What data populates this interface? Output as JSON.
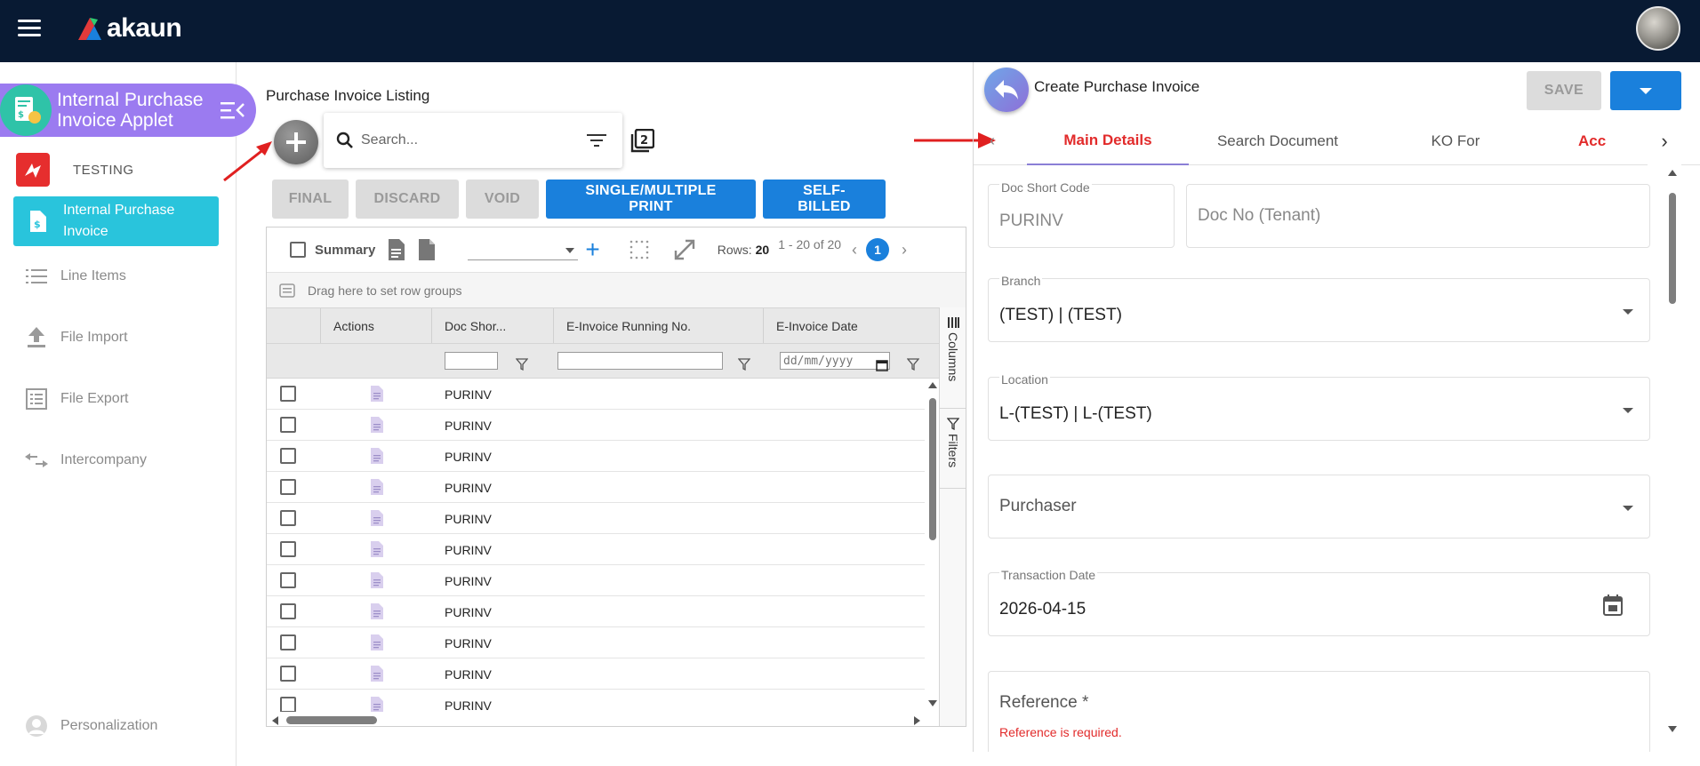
{
  "app": {
    "brand": "akaun"
  },
  "sidebar": {
    "applet_title": "Internal Purchase Invoice Applet",
    "tenant": "TESTING",
    "active_item": "Internal Purchase Invoice",
    "items": [
      {
        "label": "Line Items",
        "icon": "list-icon"
      },
      {
        "label": "File Import",
        "icon": "upload-icon"
      },
      {
        "label": "File Export",
        "icon": "export-list-icon"
      },
      {
        "label": "Intercompany",
        "icon": "swap-arrows-icon"
      }
    ],
    "personalization": "Personalization"
  },
  "listing": {
    "title": "Purchase Invoice Listing",
    "search_placeholder": "Search...",
    "buttons": {
      "final": "FINAL",
      "discard": "DISCARD",
      "void": "VOID",
      "print": "SINGLE/MULTIPLE PRINT",
      "self_billed": "SELF-BILLED"
    },
    "grid": {
      "summary_label": "Summary",
      "rows_label": "Rows:",
      "rows_value": "20",
      "range": "1 - 20 of 20",
      "page": "1",
      "group_hint": "Drag here to set row groups",
      "columns": [
        "Actions",
        "Doc Shor...",
        "E-Invoice Running No.",
        "E-Invoice Date"
      ],
      "date_placeholder": "dd/mm/yyyy",
      "side_tabs": [
        "Columns",
        "Filters"
      ],
      "rows": [
        "PURINV",
        "PURINV",
        "PURINV",
        "PURINV",
        "PURINV",
        "PURINV",
        "PURINV",
        "PURINV",
        "PURINV",
        "PURINV",
        "PURINV"
      ]
    }
  },
  "create": {
    "title": "Create Purchase Invoice",
    "save_label": "SAVE",
    "tabs": [
      "Main Details",
      "Search Document",
      "KO For",
      "Acc"
    ],
    "fields": {
      "doc_short_code_label": "Doc Short Code",
      "doc_short_code_value": "PURINV",
      "doc_no_placeholder": "Doc No (Tenant)",
      "branch_label": "Branch",
      "branch_value": "(TEST) | (TEST)",
      "location_label": "Location",
      "location_value": "L-(TEST) | L-(TEST)",
      "purchaser_placeholder": "Purchaser",
      "transaction_date_label": "Transaction Date",
      "transaction_date_value": "2026-04-15",
      "reference_placeholder": "Reference *",
      "reference_error": "Reference is required."
    }
  },
  "colors": {
    "topbar": "#081a33",
    "applet_banner": "#9b7bf0",
    "active_nav": "#29c4dc",
    "primary": "#1a80dc",
    "error": "#e22b2b"
  }
}
